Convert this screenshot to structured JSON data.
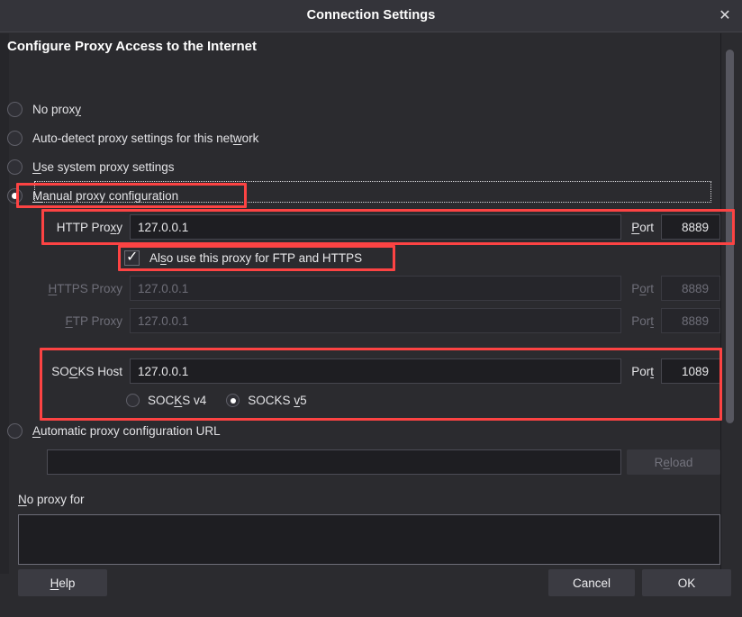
{
  "window": {
    "title": "Connection Settings",
    "close_icon": "close-icon"
  },
  "section": {
    "heading": "Configure Proxy Access to the Internet"
  },
  "proxy_modes": [
    {
      "label": "No proxy",
      "accel": "y",
      "selected": false
    },
    {
      "label": "Auto-detect proxy settings for this network",
      "accel": "w",
      "selected": false
    },
    {
      "label": "Use system proxy settings",
      "accel": "U",
      "selected": false
    },
    {
      "label": "Manual proxy configuration",
      "accel": "M",
      "selected": true
    },
    {
      "label": "Automatic proxy configuration URL",
      "accel": "A",
      "selected": false
    }
  ],
  "manual": {
    "http": {
      "label": "HTTP Proxy",
      "value": "127.0.0.1",
      "port_label": "Port",
      "port_value": "8889",
      "enabled": true
    },
    "share_checkbox": {
      "label": "Also use this proxy for FTP and HTTPS",
      "checked": true
    },
    "https": {
      "label": "HTTPS Proxy",
      "value": "127.0.0.1",
      "port_label": "Port",
      "port_value": "8889",
      "enabled": false
    },
    "ftp": {
      "label": "FTP Proxy",
      "value": "127.0.0.1",
      "port_label": "Port",
      "port_value": "8889",
      "enabled": false
    },
    "socks": {
      "label": "SOCKS Host",
      "value": "127.0.0.1",
      "port_label": "Port",
      "port_value": "1089",
      "versions": [
        {
          "label": "SOCKS v4",
          "selected": false
        },
        {
          "label": "SOCKS v5",
          "selected": true
        }
      ]
    }
  },
  "auto_url": {
    "value": "",
    "placeholder": "",
    "reload_label": "Reload",
    "reload_enabled": false
  },
  "no_proxy": {
    "label": "No proxy for",
    "value": "",
    "placeholder": ""
  },
  "buttons": {
    "help": "Help",
    "cancel": "Cancel",
    "ok": "OK"
  },
  "colors": {
    "annotation": "#fc4343",
    "window_bg": "#2b2b2f",
    "titlebar_bg": "#34343a",
    "input_bg": "#1e1e22",
    "text": "#e8e8ea",
    "disabled_text": "#6e6e78"
  }
}
